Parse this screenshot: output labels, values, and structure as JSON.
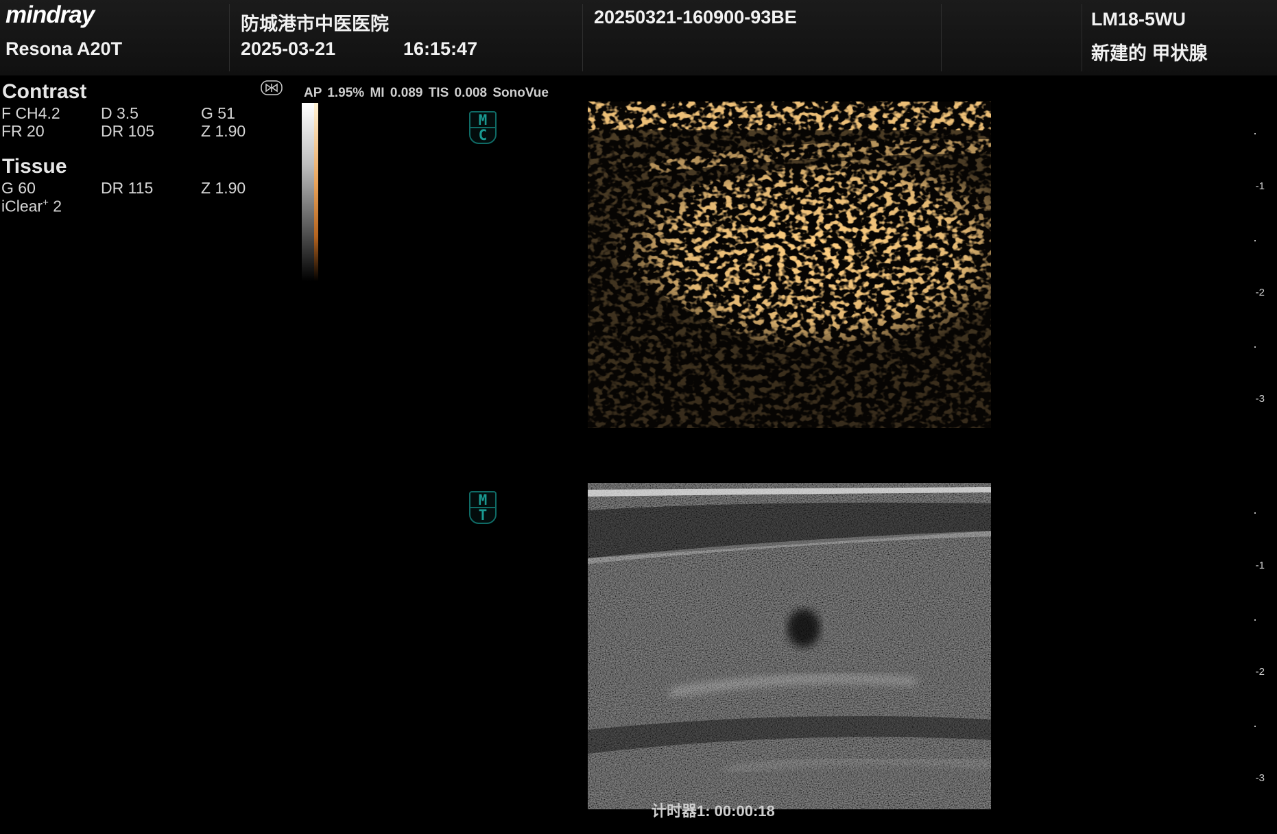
{
  "header": {
    "brand": "mindray",
    "model": "Resona A20T",
    "hospital": "防城港市中医医院",
    "date": "2025-03-21",
    "time": "16:15:47",
    "exam_id": "20250321-160900-93BE",
    "probe": "LM18-5WU",
    "preset": "新建的 甲状腺"
  },
  "contrast": {
    "title": "Contrast",
    "f": "F CH4.2",
    "d": "D 3.5",
    "g": "G 51",
    "fr": "FR 20",
    "dr": "DR 105",
    "z": "Z 1.90"
  },
  "tissue": {
    "title": "Tissue",
    "g": "G 60",
    "dr": "DR 115",
    "z": "Z 1.90",
    "iclear_prefix": "iClear",
    "iclear_sup": "+",
    "iclear_value": " 2"
  },
  "acoustic": {
    "line": "AP 1.95%  MI 0.089 TIS 0.008  SonoVue"
  },
  "badges": {
    "contrast": {
      "top": "M",
      "bottom": "C"
    },
    "tissue": {
      "top": "M",
      "bottom": "T"
    }
  },
  "depth_scale": {
    "contrast": [
      "-1",
      "-2",
      "-3"
    ],
    "tissue": [
      "-1",
      "-2",
      "-3"
    ]
  },
  "timer": {
    "text": "计时器1:  00:00:18"
  },
  "icons": {
    "probe_orientation": "probe-orientation-icon"
  }
}
